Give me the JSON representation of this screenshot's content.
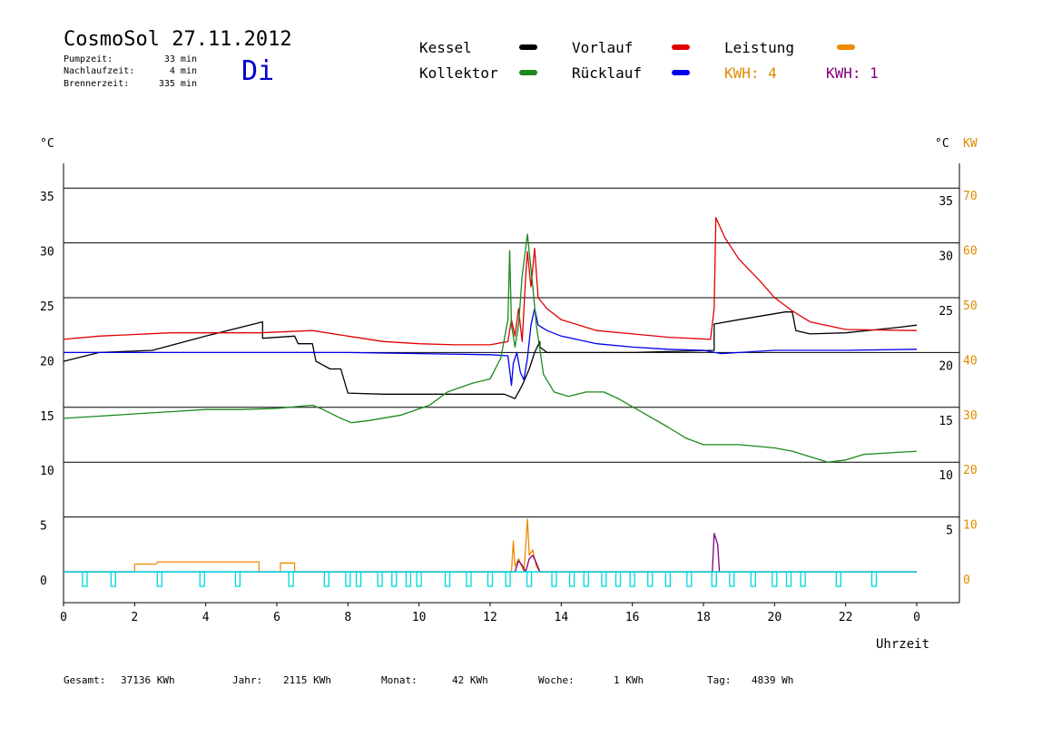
{
  "header": {
    "title": "CosmoSol 27.11.2012",
    "weekday": "Di",
    "stats": [
      {
        "label": "Pumpzeit:",
        "value": "33 min"
      },
      {
        "label": "Nachlaufzeit:",
        "value": "4 min"
      },
      {
        "label": "Brennerzeit:",
        "value": "335 min"
      }
    ]
  },
  "legend": [
    {
      "name": "Kessel",
      "color": "#000000"
    },
    {
      "name": "Vorlauf",
      "color": "#e00000"
    },
    {
      "name": "Leistung",
      "color": "#f08a00"
    },
    {
      "name": "Kollektor",
      "color": "#1a8a1a"
    },
    {
      "name": "Rücklauf",
      "color": "#0000ee"
    }
  ],
  "kwh": [
    {
      "text": "KWH: 4",
      "color": "#e08a00"
    },
    {
      "text": "KWH: 1",
      "color": "#800080"
    }
  ],
  "footer": [
    {
      "label": "Gesamt:",
      "value": "37136 KWh"
    },
    {
      "label": "Jahr:",
      "value": "2115 KWh"
    },
    {
      "label": "Monat:",
      "value": "42 KWh"
    },
    {
      "label": "Woche:",
      "value": "1 KWh"
    },
    {
      "label": "Tag:",
      "value": "4839 Wh"
    }
  ],
  "chart_data": {
    "type": "line",
    "xlabel": "Uhrzeit",
    "ylabel_left": "°C",
    "ylabel_right": [
      "°C",
      "KW"
    ],
    "x_ticks": [
      "0",
      "2",
      "4",
      "6",
      "8",
      "10",
      "12",
      "14",
      "16",
      "18",
      "20",
      "22",
      "0"
    ],
    "xlim": [
      0,
      24
    ],
    "ylim": [
      -5,
      40
    ],
    "y_ticks_left": [
      "0",
      "5",
      "10",
      "15",
      "20",
      "25",
      "30",
      "35"
    ],
    "y_ticks_right_temp": [
      "5",
      "10",
      "15",
      "20",
      "25",
      "30",
      "35"
    ],
    "y_ticks_right_kw": [
      "0",
      "10",
      "20",
      "30",
      "40",
      "50",
      "60",
      "70"
    ],
    "grid": "horizontal",
    "series": [
      {
        "name": "Kessel",
        "color": "#000000",
        "points": [
          [
            0,
            19.2
          ],
          [
            1,
            20.0
          ],
          [
            2.5,
            20.2
          ],
          [
            4,
            21.5
          ],
          [
            5.6,
            22.8
          ],
          [
            5.6,
            21.3
          ],
          [
            6.5,
            21.5
          ],
          [
            6.6,
            20.8
          ],
          [
            7,
            20.8
          ],
          [
            7.1,
            19.2
          ],
          [
            7.5,
            18.5
          ],
          [
            7.8,
            18.5
          ],
          [
            8.0,
            16.3
          ],
          [
            9,
            16.2
          ],
          [
            10,
            16.2
          ],
          [
            11,
            16.2
          ],
          [
            12.4,
            16.2
          ],
          [
            12.7,
            15.8
          ],
          [
            12.9,
            17.0
          ],
          [
            13.1,
            18.5
          ],
          [
            13.25,
            20.0
          ],
          [
            13.4,
            21.0
          ],
          [
            13.4,
            20.5
          ],
          [
            13.6,
            20.0
          ],
          [
            14,
            20.0
          ],
          [
            16,
            20.0
          ],
          [
            18.3,
            20.2
          ],
          [
            18.3,
            22.6
          ],
          [
            19,
            23.0
          ],
          [
            20.3,
            23.7
          ],
          [
            20.5,
            23.7
          ],
          [
            20.6,
            22.0
          ],
          [
            21,
            21.7
          ],
          [
            22,
            21.8
          ],
          [
            23.5,
            22.3
          ],
          [
            24,
            22.5
          ]
        ]
      },
      {
        "name": "Vorlauf",
        "color": "#e00000",
        "points": [
          [
            0,
            21.2
          ],
          [
            1,
            21.5
          ],
          [
            3,
            21.8
          ],
          [
            5.5,
            21.8
          ],
          [
            7,
            22.0
          ],
          [
            8,
            21.5
          ],
          [
            9,
            21.0
          ],
          [
            10,
            20.8
          ],
          [
            11,
            20.7
          ],
          [
            12,
            20.7
          ],
          [
            12.5,
            21.0
          ],
          [
            12.55,
            22.0
          ],
          [
            12.6,
            23.0
          ],
          [
            12.7,
            21.5
          ],
          [
            12.8,
            24.0
          ],
          [
            12.9,
            21.0
          ],
          [
            13.0,
            27.0
          ],
          [
            13.05,
            29.2
          ],
          [
            13.15,
            26.0
          ],
          [
            13.25,
            29.5
          ],
          [
            13.35,
            25.0
          ],
          [
            13.6,
            24.0
          ],
          [
            14,
            23.0
          ],
          [
            15,
            22.0
          ],
          [
            16,
            21.7
          ],
          [
            17,
            21.4
          ],
          [
            18.2,
            21.2
          ],
          [
            18.3,
            24.0
          ],
          [
            18.35,
            32.3
          ],
          [
            18.6,
            30.5
          ],
          [
            19,
            28.5
          ],
          [
            19.6,
            26.5
          ],
          [
            20,
            25.0
          ],
          [
            20.5,
            23.8
          ],
          [
            21,
            22.8
          ],
          [
            22,
            22.1
          ],
          [
            24,
            22.0
          ]
        ]
      },
      {
        "name": "Rücklauf",
        "color": "#0000ee",
        "points": [
          [
            0,
            20.0
          ],
          [
            3,
            20.0
          ],
          [
            6,
            20.0
          ],
          [
            8,
            20.0
          ],
          [
            10,
            19.9
          ],
          [
            12,
            19.8
          ],
          [
            12.5,
            19.7
          ],
          [
            12.6,
            17.0
          ],
          [
            12.65,
            19.0
          ],
          [
            12.75,
            20.0
          ],
          [
            12.85,
            18.2
          ],
          [
            12.95,
            17.5
          ],
          [
            13.05,
            19.5
          ],
          [
            13.15,
            22.5
          ],
          [
            13.25,
            24.0
          ],
          [
            13.35,
            22.5
          ],
          [
            13.6,
            22.0
          ],
          [
            14,
            21.5
          ],
          [
            15,
            20.8
          ],
          [
            16,
            20.5
          ],
          [
            17,
            20.3
          ],
          [
            18,
            20.2
          ],
          [
            18.5,
            19.9
          ],
          [
            19,
            20.0
          ],
          [
            20,
            20.2
          ],
          [
            21,
            20.2
          ],
          [
            22,
            20.2
          ],
          [
            24,
            20.3
          ]
        ]
      },
      {
        "name": "Kollektor",
        "color": "#1a8a1a",
        "points": [
          [
            0,
            14.0
          ],
          [
            1,
            14.2
          ],
          [
            2,
            14.4
          ],
          [
            3,
            14.6
          ],
          [
            4,
            14.8
          ],
          [
            5,
            14.8
          ],
          [
            6,
            14.9
          ],
          [
            7,
            15.2
          ],
          [
            7.3,
            14.8
          ],
          [
            7.8,
            14.0
          ],
          [
            8.1,
            13.6
          ],
          [
            8.6,
            13.8
          ],
          [
            9.5,
            14.3
          ],
          [
            10.3,
            15.2
          ],
          [
            10.8,
            16.4
          ],
          [
            11.5,
            17.2
          ],
          [
            12.0,
            17.6
          ],
          [
            12.3,
            19.5
          ],
          [
            12.5,
            23.0
          ],
          [
            12.55,
            29.3
          ],
          [
            12.6,
            22.5
          ],
          [
            12.7,
            20.5
          ],
          [
            12.8,
            22.5
          ],
          [
            12.9,
            27.0
          ],
          [
            13.05,
            30.8
          ],
          [
            13.2,
            26.0
          ],
          [
            13.3,
            22.5
          ],
          [
            13.5,
            18.0
          ],
          [
            13.8,
            16.4
          ],
          [
            14.2,
            16.0
          ],
          [
            14.7,
            16.4
          ],
          [
            15.2,
            16.4
          ],
          [
            15.6,
            15.8
          ],
          [
            16.3,
            14.5
          ],
          [
            17,
            13.2
          ],
          [
            17.5,
            12.2
          ],
          [
            18,
            11.6
          ],
          [
            19,
            11.6
          ],
          [
            20,
            11.3
          ],
          [
            20.5,
            11.0
          ],
          [
            21,
            10.5
          ],
          [
            21.5,
            10.0
          ],
          [
            22,
            10.2
          ],
          [
            22.5,
            10.7
          ],
          [
            23,
            10.8
          ],
          [
            24,
            11.0
          ]
        ]
      },
      {
        "name": "Leistung",
        "color": "#f08a00",
        "points": [
          [
            0,
            0
          ],
          [
            2.0,
            0
          ],
          [
            2.0,
            0.7
          ],
          [
            2.6,
            0.7
          ],
          [
            2.65,
            0.9
          ],
          [
            5.5,
            0.9
          ],
          [
            5.5,
            0
          ],
          [
            6.1,
            0
          ],
          [
            6.1,
            0.8
          ],
          [
            6.5,
            0.8
          ],
          [
            6.5,
            0
          ],
          [
            12.6,
            0
          ],
          [
            12.65,
            2.8
          ],
          [
            12.7,
            0.5
          ],
          [
            12.8,
            1.2
          ],
          [
            12.95,
            0
          ],
          [
            13.05,
            4.8
          ],
          [
            13.1,
            1.5
          ],
          [
            13.2,
            2.0
          ],
          [
            13.3,
            0.5
          ],
          [
            13.4,
            0
          ],
          [
            24,
            0
          ]
        ]
      },
      {
        "name": "KWH 1",
        "color": "#800080",
        "points": [
          [
            0,
            0
          ],
          [
            12.7,
            0
          ],
          [
            12.8,
            1.0
          ],
          [
            12.9,
            0.6
          ],
          [
            13.0,
            0
          ],
          [
            13.1,
            1.2
          ],
          [
            13.2,
            1.5
          ],
          [
            13.3,
            0.8
          ],
          [
            13.4,
            0
          ],
          [
            18.25,
            0
          ],
          [
            18.3,
            3.5
          ],
          [
            18.4,
            2.5
          ],
          [
            18.45,
            0
          ],
          [
            24,
            0
          ]
        ]
      },
      {
        "name": "Pumpe",
        "color": "#00d8e0",
        "pulses": [
          0.6,
          1.4,
          2.7,
          3.9,
          4.9,
          6.4,
          7.4,
          8.0,
          8.3,
          8.9,
          9.3,
          9.7,
          10.0,
          10.8,
          11.4,
          12.0,
          12.5,
          13.1,
          13.8,
          14.3,
          14.7,
          15.2,
          15.6,
          16.0,
          16.5,
          17.0,
          17.6,
          18.3,
          18.8,
          19.4,
          20.0,
          20.4,
          20.8,
          21.8,
          22.8
        ]
      }
    ]
  }
}
